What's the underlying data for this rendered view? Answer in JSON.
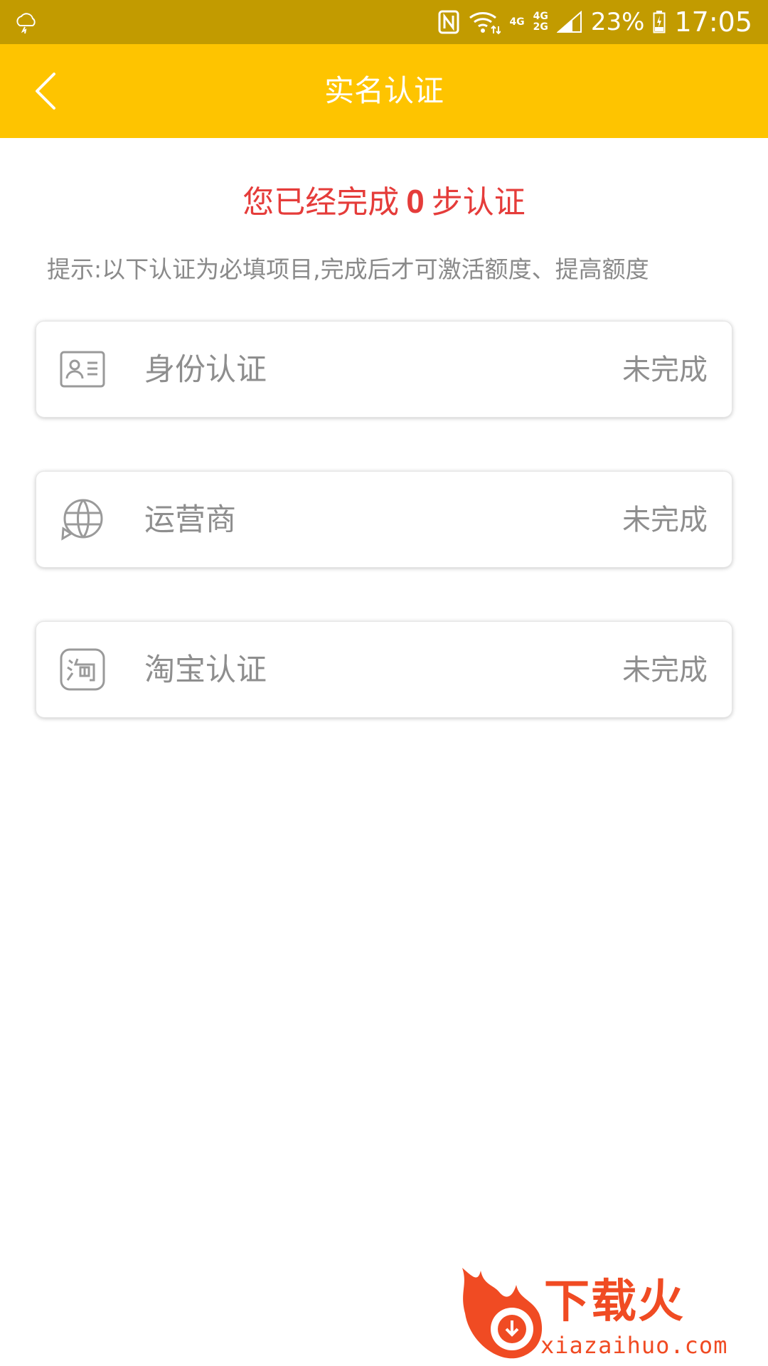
{
  "status_bar": {
    "left_icon": "weather-cloud-icon",
    "network_top": "4G",
    "network_dual": [
      "4G",
      "2G"
    ],
    "battery": "23%",
    "time": "17:05"
  },
  "header": {
    "back_icon": "chevron-left-icon",
    "title": "实名认证"
  },
  "progress": {
    "prefix": "您已经完成",
    "count": "0",
    "suffix": "步认证"
  },
  "tip": "提示:以下认证为必填项目,完成后才可激活额度、提高额度",
  "items": [
    {
      "icon": "id-card-icon",
      "label": "身份认证",
      "status": "未完成"
    },
    {
      "icon": "carrier-globe-icon",
      "label": "运营商",
      "status": "未完成"
    },
    {
      "icon": "taobao-icon",
      "label": "淘宝认证",
      "status": "未完成"
    }
  ],
  "watermark": {
    "brand": "下载火",
    "domain": "xiazaihuo.com"
  },
  "colors": {
    "status_bar": "#c29b00",
    "header": "#fec400",
    "accent_red": "#e53c3a",
    "text_gray": "#8e8e8e",
    "watermark": "#f04b23"
  }
}
